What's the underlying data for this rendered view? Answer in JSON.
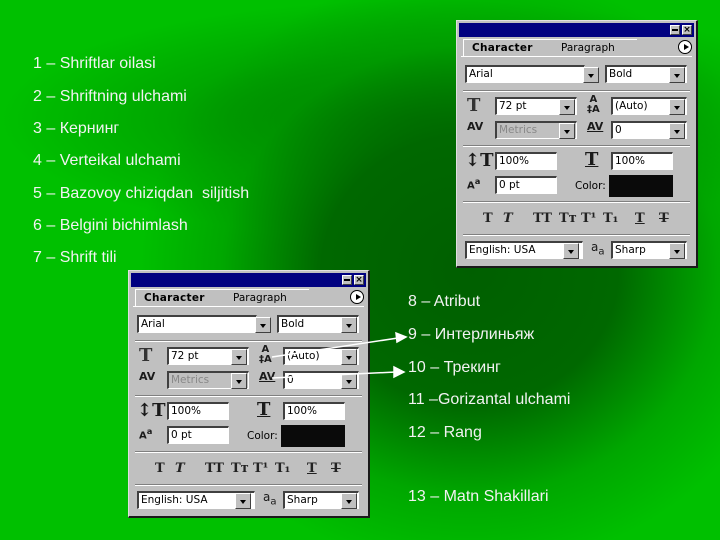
{
  "labels": [
    "1 – Shriftlar oilasi",
    "2 – Shriftning ulchami",
    "3 – Кернинг",
    "4 – Verteikal ulchami",
    "5 – Bazovoy chiziqdan  siljitish",
    "6 – Belgini bichimlash",
    "7 – Shrift tili",
    "8 – Atribut",
    "9 – Интерлиньяж",
    "10 – Трекинг",
    "11 –Gorizantal ulchami",
    "12 – Rang",
    "13 – Matn Shakillari"
  ],
  "palette": {
    "tabs": {
      "active": "Character",
      "inactive": "Paragraph"
    },
    "font_family": "Arial",
    "font_style": "Bold",
    "font_size": "72 pt",
    "leading": "(Auto)",
    "kerning": "Metrics",
    "tracking": "0",
    "vertical_scale": "100%",
    "horizontal_scale": "100%",
    "baseline_shift": "0 pt",
    "color_label": "Color:",
    "color_value": "#0a0a0a",
    "language": "English: USA",
    "antialias": "Sharp",
    "style_buttons": [
      "T",
      "T",
      "TT",
      "Tт",
      "T¹",
      "T₁",
      "T",
      "T"
    ]
  },
  "colors": {
    "background_edge": "#00c000",
    "background_center": "#005f00",
    "title_bar": "#000080",
    "panel": "#c0c0c0"
  }
}
